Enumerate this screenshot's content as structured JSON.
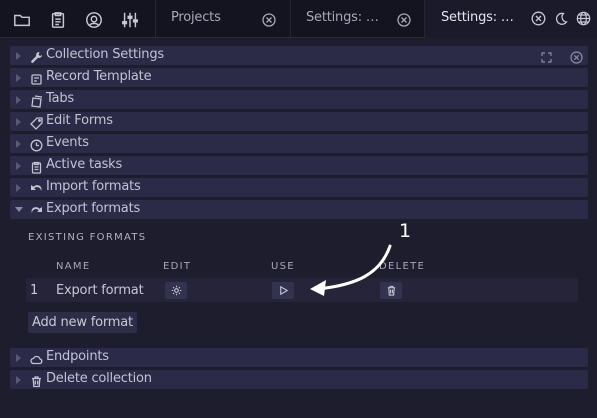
{
  "topbar": {
    "nav_icons": [
      "folder-icon",
      "clipboard-icon",
      "user-circle-icon",
      "sliders-icon"
    ],
    "tabs": [
      {
        "label": "Projects",
        "active": false
      },
      {
        "label": "Settings: …",
        "active": false
      },
      {
        "label": "Settings: …",
        "active": true
      }
    ],
    "right_icons": [
      "close-circle-icon",
      "moon-icon",
      "globe-icon"
    ]
  },
  "sections": [
    {
      "label": "Collection Settings",
      "icon": "wrench-icon",
      "expanded": false
    },
    {
      "label": "Record Template",
      "icon": "record-icon",
      "expanded": false
    },
    {
      "label": "Tabs",
      "icon": "tabs-icon",
      "expanded": false
    },
    {
      "label": "Edit Forms",
      "icon": "tag-icon",
      "expanded": false
    },
    {
      "label": "Events",
      "icon": "clock-icon",
      "expanded": false
    },
    {
      "label": "Active tasks",
      "icon": "clipboard-icon",
      "expanded": false
    },
    {
      "label": "Import formats",
      "icon": "undo-icon",
      "expanded": false
    },
    {
      "label": "Export formats",
      "icon": "redo-icon",
      "expanded": true
    },
    {
      "label": "Endpoints",
      "icon": "cloud-icon",
      "expanded": false
    },
    {
      "label": "Delete collection",
      "icon": "trash-icon",
      "expanded": false
    }
  ],
  "export_formats": {
    "header": "EXISTING FORMATS",
    "columns": [
      "NAME",
      "EDIT",
      "USE",
      "DELETE"
    ],
    "rows": [
      {
        "index": "1",
        "name": "Export format"
      }
    ],
    "add_button": "Add new format"
  },
  "annotation": {
    "label": "1"
  },
  "colors": {
    "background": "#1e1d2d",
    "topbar": "#141320",
    "section_row": "#2b2a47",
    "text": "#c9c8d6",
    "annotation": "#ffffff"
  }
}
